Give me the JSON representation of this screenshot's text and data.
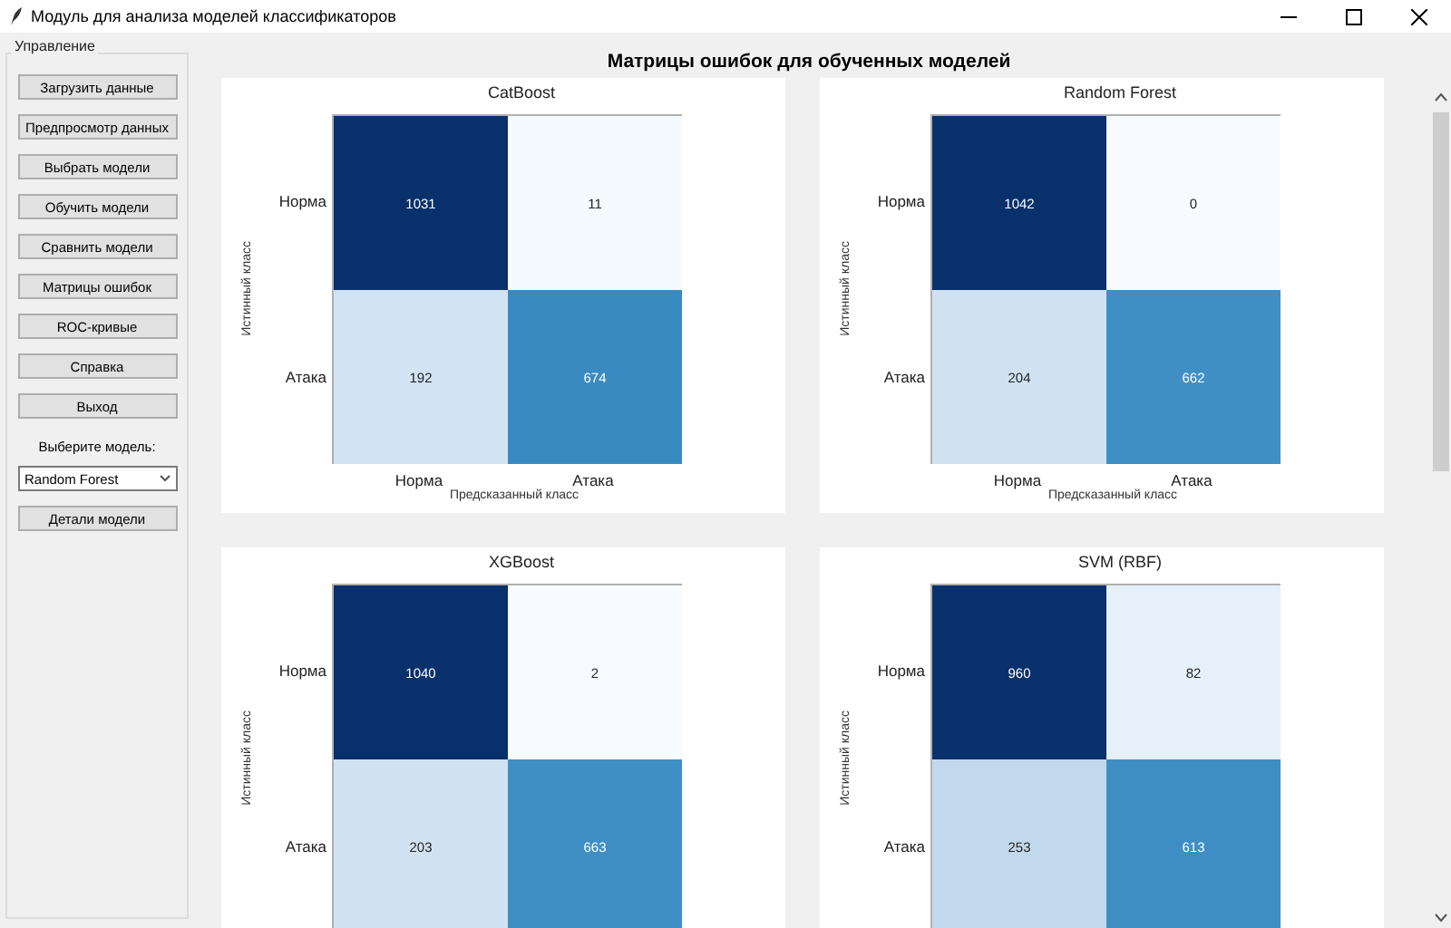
{
  "window": {
    "title": "Модуль для анализа моделей классификаторов"
  },
  "sidebar": {
    "group_title": "Управление",
    "buttons": [
      "Загрузить данные",
      "Предпросмотр данных",
      "Выбрать модели",
      "Обучить модели",
      "Сравнить модели",
      "Матрицы ошибок",
      "ROC-кривые",
      "Справка",
      "Выход"
    ],
    "model_label": "Выберите модель:",
    "model_select": {
      "value": "Random Forest"
    },
    "details_button": "Детали модели"
  },
  "main": {
    "title": "Матрицы ошибок для обученных моделей",
    "matrices": [
      {
        "title": "CatBoost",
        "ylabel": "Истинный класс",
        "row_labels": [
          "Норма",
          "Атака"
        ],
        "cells": [
          [
            "1031",
            "11"
          ],
          [
            "192",
            "674"
          ]
        ],
        "col_labels": [
          "Норма",
          "Атака"
        ],
        "xlabel": "Предсказанный класс"
      },
      {
        "title": "Random Forest",
        "ylabel": "Истинный класс",
        "row_labels": [
          "Норма",
          "Атака"
        ],
        "cells": [
          [
            "1042",
            "0"
          ],
          [
            "204",
            "662"
          ]
        ],
        "col_labels": [
          "Норма",
          "Атака"
        ],
        "xlabel": "Предсказанный класс"
      },
      {
        "title": "XGBoost",
        "ylabel": "Истинный класс",
        "row_labels": [
          "Норма",
          "Атака"
        ],
        "cells": [
          [
            "1040",
            "2"
          ],
          [
            "203",
            "663"
          ]
        ]
      },
      {
        "title": "SVM (RBF)",
        "ylabel": "Истинный класс",
        "row_labels": [
          "Норма",
          "Атака"
        ],
        "cells": [
          [
            "960",
            "82"
          ],
          [
            "253",
            "613"
          ]
        ]
      }
    ]
  }
}
